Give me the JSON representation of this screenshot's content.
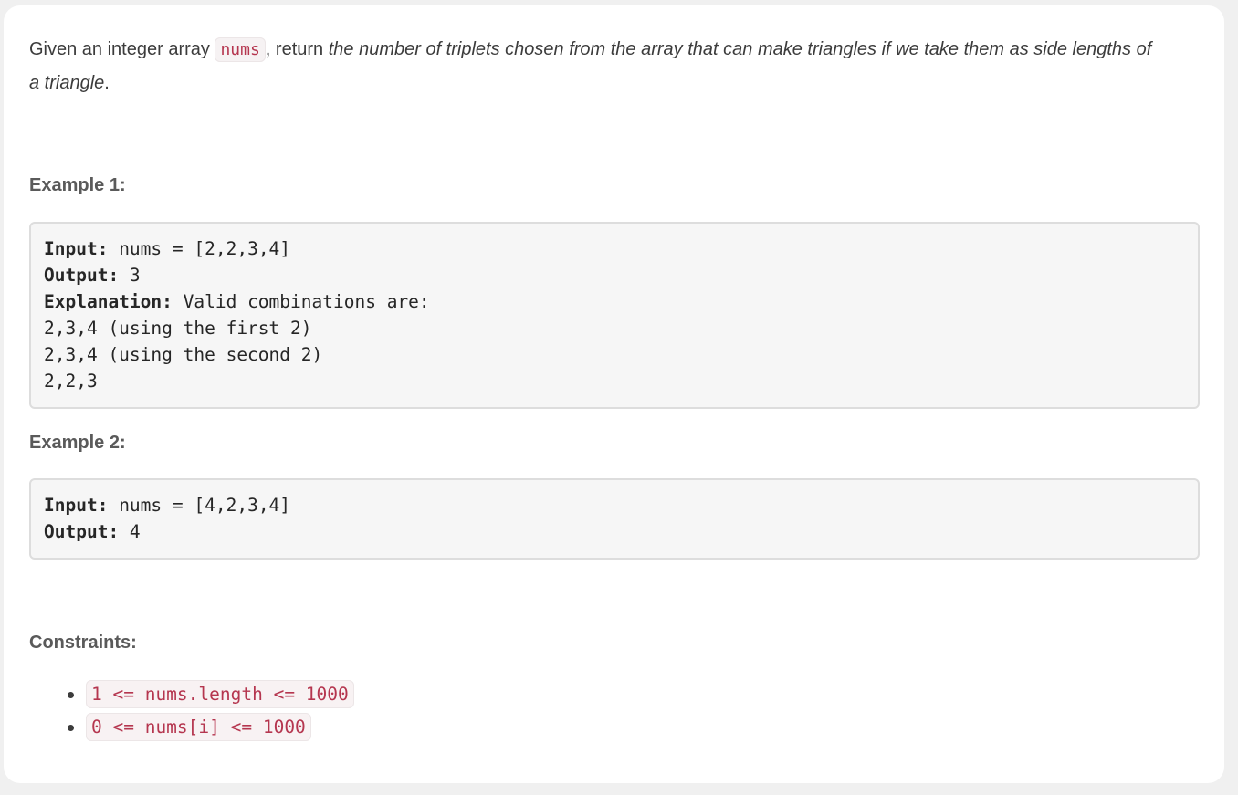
{
  "description": {
    "prefix": "Given an integer array ",
    "code": "nums",
    "middle": ", return ",
    "italic": "the number of triplets chosen from the array that can make triangles if we take them as side lengths of a triangle",
    "suffix": "."
  },
  "example1": {
    "heading": "Example 1:",
    "input_label": "Input:",
    "input_value": " nums = [2,2,3,4]",
    "output_label": "Output:",
    "output_value": " 3",
    "explanation_label": "Explanation:",
    "explanation_value": " Valid combinations are:",
    "lines": [
      "2,3,4 (using the first 2)",
      "2,3,4 (using the second 2)",
      "2,2,3"
    ]
  },
  "example2": {
    "heading": "Example 2:",
    "input_label": "Input:",
    "input_value": " nums = [4,2,3,4]",
    "output_label": "Output:",
    "output_value": " 4"
  },
  "constraints": {
    "heading": "Constraints:",
    "items": [
      "1 <= nums.length <= 1000",
      "0 <= nums[i] <= 1000"
    ]
  }
}
